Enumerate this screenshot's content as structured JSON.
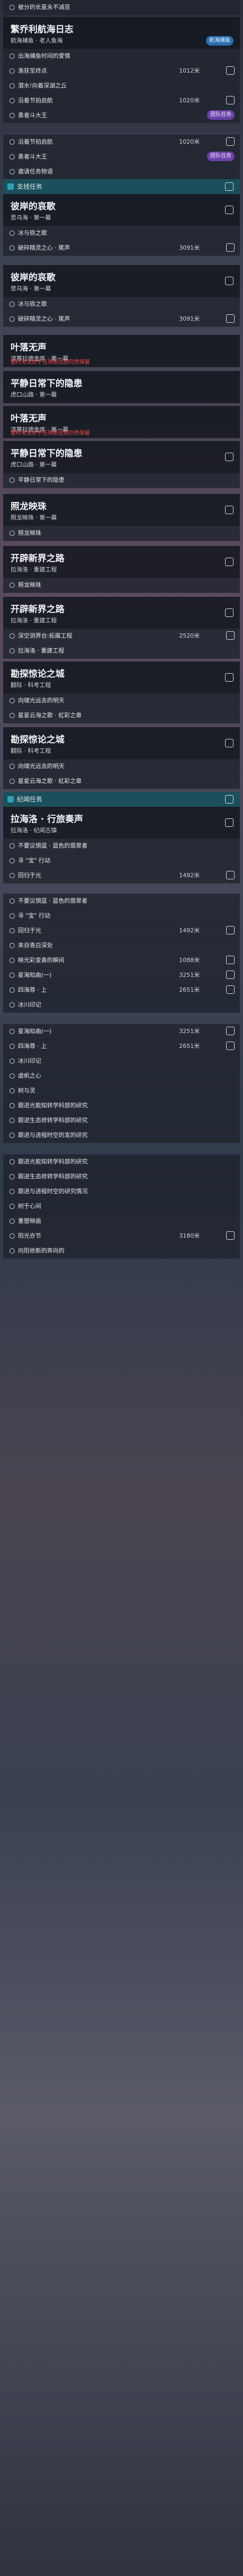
{
  "top_partial": {
    "label": "被分的长夏永不减亚"
  },
  "cards": [
    {
      "title": "繁乔利航海日志",
      "subtitle": "航海捕鱼 · 老人鱼海",
      "badge": "航海捕鱼"
    },
    {
      "title": "彼岸的哀歌",
      "subtitle": "悲乌海 · 第一幕"
    },
    {
      "title": "彼岸的哀歌",
      "subtitle": "悲乌海 · 第一幕"
    },
    {
      "title": "叶落无声",
      "subtitle": "滨寒拉德金库 · 第一幕",
      "warn": "暂时无法处于任务前往后仍然保留"
    },
    {
      "title": "平静日常下的隐患",
      "subtitle": "虎口山路 · 第一幕"
    },
    {
      "title": "叶落无声",
      "subtitle": "滨寒拉德金库 · 第一幕",
      "warn": "暂时无法处于任务前往后仍然保留"
    },
    {
      "title": "平静日常下的隐患",
      "subtitle": "虎口山路 · 第一幕"
    },
    {
      "title": "照龙映珠",
      "subtitle": "照龙映珠 · 第一幕"
    },
    {
      "title": "开辟新界之路",
      "subtitle": "拉海洛 · 重建工程"
    },
    {
      "title": "开辟新界之路",
      "subtitle": "拉海洛 · 重建工程"
    },
    {
      "title": "勘探惊论之城",
      "subtitle": "翻际 · 科考工程"
    },
    {
      "title": "勘探惊论之城",
      "subtitle": "翻际 · 科考工程"
    },
    {
      "title": "拉海洛 · 行旅奏声",
      "subtitle": "拉海洛 · 纪闻古镇"
    }
  ],
  "sections": [
    {
      "label": "支线任务"
    },
    {
      "label": "纪闻任务"
    }
  ],
  "rows": [
    {
      "label": "出海捕鱼时间的爱情",
      "dist": ""
    },
    {
      "label": "渔获至终点",
      "dist": "1012米"
    },
    {
      "label": "潜水!向着深湖之丘",
      "dist": ""
    },
    {
      "label": "沿着节拍启航",
      "dist": "1020米"
    },
    {
      "label": "勇者斗大王",
      "dist": ""
    },
    {
      "label": "团队任务",
      "dist": ""
    },
    {
      "label": "沿着节拍启航",
      "dist": "1020米"
    },
    {
      "label": "勇者斗大王",
      "dist": ""
    },
    {
      "label": "邀请任务物语",
      "dist": ""
    },
    {
      "label": "冰与铁之歌",
      "dist": ""
    },
    {
      "label": "破碎精灵之心 · 尾声",
      "dist": "3091米"
    },
    {
      "label": "冰与铁之歌",
      "dist": ""
    },
    {
      "label": "破碎精灵之心 · 尾声",
      "dist": "3091米"
    },
    {
      "label": "彼岸的哀歌",
      "dist": ""
    },
    {
      "label": "平静日常下的隐患",
      "dist": ""
    },
    {
      "label": "照龙映珠",
      "dist": ""
    },
    {
      "label": "照龙映珠",
      "dist": ""
    },
    {
      "label": "深空测界台:拓展工程",
      "dist": "2520米"
    },
    {
      "label": "拉海洛 · 重建工程",
      "dist": ""
    },
    {
      "label": "向啸光远去的明天",
      "dist": ""
    },
    {
      "label": "星星云海之歌 · 虹彩之章",
      "dist": ""
    },
    {
      "label": "向啸光远去的明天",
      "dist": ""
    },
    {
      "label": "星星云海之歌 · 虹彩之章",
      "dist": ""
    },
    {
      "label": "不要议惧蓝 · 蓝色的翡翠者",
      "dist": ""
    },
    {
      "label": "寻 \"宝\" 行动",
      "dist": ""
    },
    {
      "label": "回归于光",
      "dist": "1492米"
    },
    {
      "label": "不要议惧蓝 · 蓝色的翡翠者",
      "dist": ""
    },
    {
      "label": "寻 \"宝\" 行动",
      "dist": ""
    },
    {
      "label": "回归于光",
      "dist": "1492米"
    },
    {
      "label": "来自青白深处",
      "dist": ""
    },
    {
      "label": "映光彩变奏的瞬间",
      "dist": "1088米"
    },
    {
      "label": "星海知曲(一)",
      "dist": "3251米"
    },
    {
      "label": "四海尊 · 上",
      "dist": "2651米"
    },
    {
      "label": "冰川印记",
      "dist": ""
    },
    {
      "label": "星海知曲(一)",
      "dist": "3251米"
    },
    {
      "label": "四海尊 · 上",
      "dist": "2651米"
    },
    {
      "label": "冰川印记",
      "dist": ""
    },
    {
      "label": "虐帆之心",
      "dist": ""
    },
    {
      "label": "树与灵",
      "dist": ""
    },
    {
      "label": "跟进光能知转学科部的研究",
      "dist": ""
    },
    {
      "label": "跟进生态修转学科部的研究",
      "dist": ""
    },
    {
      "label": "跟进与进程时空的发的研究",
      "dist": ""
    },
    {
      "label": "跟进光能知转学科部的研究",
      "dist": ""
    },
    {
      "label": "跟进生态修转学科部的研究",
      "dist": ""
    },
    {
      "label": "跟进与进程时空的研究情况",
      "dist": ""
    },
    {
      "label": "树于心间",
      "dist": ""
    },
    {
      "label": "重塑映画",
      "dist": ""
    },
    {
      "label": "阳光亦节",
      "dist": "3180米"
    },
    {
      "label": "向阳依新的奔向的",
      "dist": ""
    }
  ],
  "colors": {
    "accent_teal": "#1b4f5b",
    "warn_red": "#ff4a4a",
    "badge_cream": "#e9e0c8",
    "badge_blue": "#2b6fb0",
    "badge_purple": "#6b42a8"
  }
}
